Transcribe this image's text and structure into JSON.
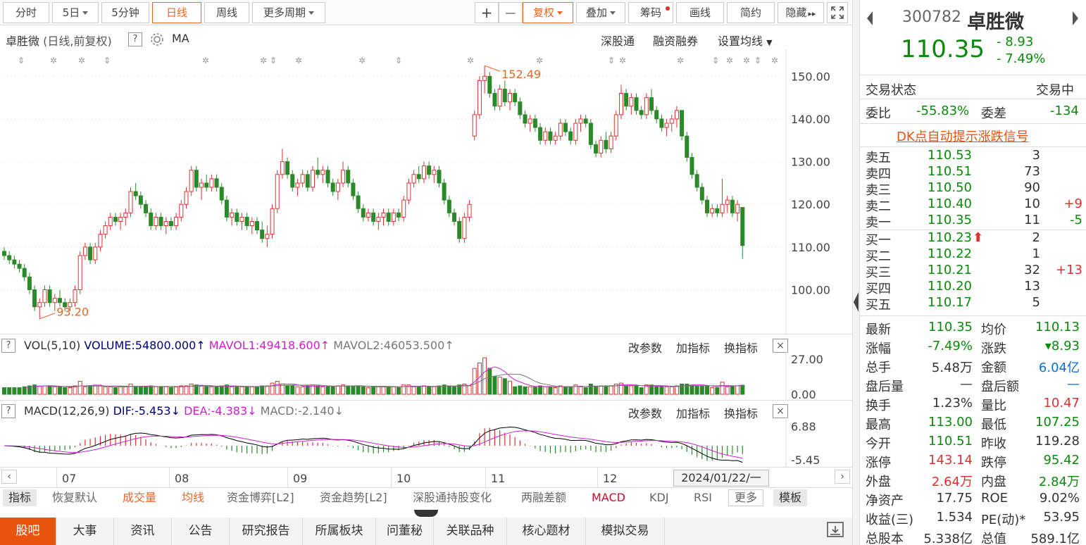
{
  "toolbar": {
    "tab_fenshi": "分时",
    "tab_5day": "5日",
    "tab_5min": "5分钟",
    "tab_daily": "日线",
    "tab_weekly": "周线",
    "tab_more": "更多周期",
    "plus": "+",
    "minus": "—",
    "fuquan": "复权",
    "diejia": "叠加",
    "chouma": "筹码",
    "huaxian": "画线",
    "jianyue": "简约",
    "yincang": "隐藏",
    "more_arrow": "▸▸"
  },
  "chart_header": {
    "title": "卓胜微",
    "subtitle": "(日线,前复权)",
    "help": "?",
    "ma": "MA",
    "link1": "深股通",
    "link2": "融资融券",
    "link3": "设置均线"
  },
  "price_annot": {
    "high": "152.49",
    "low": "93.20"
  },
  "chart_data": [
    {
      "type": "candlestick",
      "ylim": [
        92,
        155
      ],
      "y_ticks": [
        "150.00",
        "140.00",
        "130.00",
        "120.00",
        "110.00",
        "100.00"
      ],
      "y_tick_values": [
        150,
        140,
        130,
        120,
        110,
        100
      ],
      "x_ticks": [
        "07",
        "08",
        "09",
        "10",
        "11",
        "12"
      ],
      "last_date": "2024/01/22/一",
      "ohlc": [
        [
          109,
          110,
          107,
          108
        ],
        [
          108,
          109,
          106,
          107
        ],
        [
          107,
          108,
          105,
          106
        ],
        [
          106,
          107,
          104,
          105
        ],
        [
          105,
          106,
          102,
          103
        ],
        [
          103,
          104,
          99,
          100
        ],
        [
          100,
          101,
          95,
          96
        ],
        [
          96,
          98,
          93.2,
          97
        ],
        [
          97,
          101,
          96,
          100
        ],
        [
          100,
          101,
          96,
          97
        ],
        [
          97,
          99,
          95,
          98
        ],
        [
          98,
          100,
          96,
          97
        ],
        [
          97,
          98,
          95,
          96
        ],
        [
          96,
          98,
          95,
          97
        ],
        [
          97,
          101,
          96,
          100
        ],
        [
          100,
          109,
          99,
          108
        ],
        [
          108,
          111,
          107,
          110
        ],
        [
          110,
          111,
          106,
          107
        ],
        [
          107,
          111,
          106,
          110
        ],
        [
          110,
          114,
          109,
          113
        ],
        [
          113,
          116,
          112,
          115
        ],
        [
          115,
          118,
          114,
          117
        ],
        [
          117,
          118,
          115,
          116
        ],
        [
          116,
          118,
          114,
          117
        ],
        [
          117,
          119,
          115,
          118
        ],
        [
          118,
          124,
          117,
          123
        ],
        [
          123,
          125,
          121,
          122
        ],
        [
          122,
          123,
          119,
          120
        ],
        [
          120,
          121,
          117,
          118
        ],
        [
          118,
          119,
          114,
          115
        ],
        [
          115,
          118,
          114,
          117
        ],
        [
          117,
          118,
          114,
          115
        ],
        [
          115,
          117,
          113,
          116
        ],
        [
          116,
          117,
          114,
          115
        ],
        [
          115,
          118,
          114,
          117
        ],
        [
          117,
          121,
          116,
          120
        ],
        [
          120,
          124,
          119,
          123
        ],
        [
          123,
          129,
          122,
          128
        ],
        [
          128,
          129,
          123,
          124
        ],
        [
          124,
          126,
          121,
          125
        ],
        [
          125,
          127,
          123,
          124
        ],
        [
          124,
          127,
          123,
          126
        ],
        [
          126,
          127,
          123,
          124
        ],
        [
          124,
          125,
          120,
          121
        ],
        [
          121,
          122,
          116,
          117
        ],
        [
          117,
          119,
          115,
          118
        ],
        [
          118,
          119,
          115,
          116
        ],
        [
          116,
          118,
          114,
          117
        ],
        [
          117,
          118,
          114,
          115
        ],
        [
          115,
          117,
          113,
          116
        ],
        [
          116,
          117,
          113,
          114
        ],
        [
          114,
          116,
          111,
          112
        ],
        [
          112,
          115,
          110,
          113
        ],
        [
          113,
          120,
          112,
          119
        ],
        [
          119,
          128,
          118,
          127
        ],
        [
          127,
          133,
          126,
          130
        ],
        [
          130,
          131,
          126,
          127
        ],
        [
          127,
          128,
          123,
          124
        ],
        [
          124,
          126,
          122,
          125
        ],
        [
          125,
          128,
          124,
          127
        ],
        [
          127,
          128,
          123,
          124
        ],
        [
          124,
          129,
          123,
          128
        ],
        [
          128,
          131,
          126,
          127
        ],
        [
          127,
          129,
          125,
          128
        ],
        [
          128,
          129,
          124,
          125
        ],
        [
          125,
          126,
          122,
          123
        ],
        [
          123,
          126,
          121,
          125
        ],
        [
          125,
          130,
          124,
          128
        ],
        [
          128,
          129,
          124,
          125
        ],
        [
          125,
          126,
          121,
          122
        ],
        [
          122,
          123,
          118,
          119
        ],
        [
          119,
          120,
          116,
          117
        ],
        [
          117,
          119,
          116,
          118
        ],
        [
          118,
          119,
          115,
          116
        ],
        [
          116,
          118,
          114,
          117
        ],
        [
          117,
          119,
          115,
          118
        ],
        [
          118,
          119,
          115,
          116
        ],
        [
          116,
          119,
          115,
          118
        ],
        [
          118,
          119,
          116,
          117
        ],
        [
          117,
          122,
          116,
          121
        ],
        [
          121,
          126,
          120,
          125
        ],
        [
          125,
          128,
          124,
          127
        ],
        [
          127,
          129,
          125,
          126
        ],
        [
          126,
          130,
          125,
          129
        ],
        [
          129,
          130,
          126,
          127
        ],
        [
          127,
          129,
          125,
          128
        ],
        [
          128,
          129,
          124,
          125
        ],
        [
          125,
          126,
          120,
          121
        ],
        [
          121,
          122,
          117,
          118
        ],
        [
          118,
          119,
          115,
          116
        ],
        [
          116,
          117,
          111,
          112
        ],
        [
          112,
          118,
          111,
          117
        ],
        [
          117,
          121,
          116,
          120
        ],
        [
          136,
          142,
          135,
          141
        ],
        [
          141,
          150,
          140,
          149
        ],
        [
          149,
          152.49,
          146,
          150
        ],
        [
          150,
          151,
          145,
          146
        ],
        [
          146,
          147,
          142,
          143
        ],
        [
          143,
          148,
          142,
          147
        ],
        [
          147,
          149,
          143,
          144
        ],
        [
          144,
          147,
          142,
          146
        ],
        [
          146,
          147,
          143,
          144
        ],
        [
          144,
          145,
          140,
          141
        ],
        [
          141,
          142,
          138,
          139
        ],
        [
          139,
          141,
          137,
          140
        ],
        [
          140,
          141,
          137,
          138
        ],
        [
          138,
          139,
          134,
          135
        ],
        [
          135,
          138,
          134,
          137
        ],
        [
          137,
          138,
          134,
          135
        ],
        [
          135,
          137,
          134,
          136
        ],
        [
          136,
          140,
          135,
          139
        ],
        [
          139,
          140,
          136,
          137
        ],
        [
          137,
          138,
          134,
          135
        ],
        [
          135,
          140,
          134,
          139
        ],
        [
          139,
          141,
          137,
          140
        ],
        [
          140,
          141,
          138,
          139
        ],
        [
          139,
          140,
          133,
          134
        ],
        [
          134,
          135,
          131,
          132
        ],
        [
          132,
          136,
          131,
          135
        ],
        [
          135,
          137,
          132,
          133
        ],
        [
          133,
          137,
          132,
          136
        ],
        [
          136,
          142,
          135,
          141
        ],
        [
          141,
          148,
          140,
          146
        ],
        [
          146,
          147,
          142,
          143
        ],
        [
          143,
          146,
          141,
          145
        ],
        [
          145,
          146,
          141,
          142
        ],
        [
          142,
          143,
          140,
          141
        ],
        [
          141,
          146,
          140,
          145
        ],
        [
          145,
          147,
          141,
          142
        ],
        [
          142,
          143,
          139,
          140
        ],
        [
          140,
          141,
          137,
          138
        ],
        [
          138,
          140,
          136,
          139
        ],
        [
          139,
          141,
          137,
          140
        ],
        [
          140,
          143,
          138,
          142
        ],
        [
          142,
          142,
          135,
          136
        ],
        [
          136,
          137,
          130,
          131
        ],
        [
          131,
          132,
          126,
          127
        ],
        [
          127,
          128,
          123,
          124
        ],
        [
          124,
          125,
          120,
          121
        ],
        [
          121,
          122,
          117,
          118
        ],
        [
          118,
          120,
          117,
          119
        ],
        [
          119,
          120,
          117,
          118
        ],
        [
          118,
          126,
          117,
          120
        ],
        [
          120,
          122,
          118,
          121
        ],
        [
          121,
          122,
          117,
          118
        ],
        [
          118,
          121,
          116,
          120
        ],
        [
          119.28,
          113,
          107.25,
          110.35
        ]
      ]
    },
    {
      "type": "bar",
      "name": "VOL",
      "y_ticks": [
        "27.00",
        "0.00"
      ],
      "ylim": [
        0,
        30
      ]
    },
    {
      "type": "line",
      "name": "MACD",
      "y_ticks": [
        "6.88",
        "-5.45"
      ],
      "ylim": [
        -6,
        9
      ]
    }
  ],
  "vol_header": {
    "help": "?",
    "label": "VOL(5,10)",
    "volume": "VOLUME:54800.000",
    "mavol1": "MAVOL1:49418.600",
    "mavol2": "MAVOL2:46053.500",
    "gaicanshu": "改参数",
    "jiazhibiao": "加指标",
    "huanzhibiao": "换指标",
    "close": "×",
    "color_volume": "#000080",
    "color_mavol1": "#d020d0",
    "color_mavol2": "#777777"
  },
  "macd_header": {
    "help": "?",
    "label": "MACD(12,26,9)",
    "dif": "DIF:-5.453",
    "dea": "DEA:-4.383",
    "macd": "MACD:-2.140",
    "gaicanshu": "改参数",
    "jiazhibiao": "加指标",
    "huanzhibiao": "换指标",
    "close": "×"
  },
  "nav": {
    "left": "‹",
    "right": "›"
  },
  "indicator_tabs": [
    "指标",
    "恢复默认",
    "成交量",
    "均线",
    "资金博弈[L2]",
    "资金趋势[L2]",
    "深股通持股变化",
    "两融差额",
    "MACD",
    "KDJ",
    "RSI",
    "更多",
    "模板"
  ],
  "bottom_tabs": [
    "股吧",
    "大事",
    "资讯",
    "公告",
    "研究报告",
    "所属板块",
    "问董秘",
    "关联品种",
    "核心题材",
    "模拟交易"
  ],
  "quote": {
    "code": "300782",
    "name": "卓胜微",
    "price": "110.35",
    "change": "- 8.93",
    "change_pct": "- 7.49%",
    "status_label": "交易状态",
    "status_value": "交易中",
    "weibi_label": "委比",
    "weibi_value": "-55.83%",
    "weicha_label": "委差",
    "weicha_value": "-134",
    "dk_signal": "DK点自动提示涨跌信号",
    "asks": [
      {
        "label": "卖五",
        "price": "110.53",
        "vol": "3",
        "chg": ""
      },
      {
        "label": "卖四",
        "price": "110.51",
        "vol": "73",
        "chg": ""
      },
      {
        "label": "卖三",
        "price": "110.50",
        "vol": "90",
        "chg": ""
      },
      {
        "label": "卖二",
        "price": "110.40",
        "vol": "10",
        "chg": "+9"
      },
      {
        "label": "卖一",
        "price": "110.35",
        "vol": "11",
        "chg": "-5"
      }
    ],
    "bids": [
      {
        "label": "买一",
        "price": "110.23",
        "vol": "2",
        "chg": ""
      },
      {
        "label": "买二",
        "price": "110.22",
        "vol": "1",
        "chg": ""
      },
      {
        "label": "买三",
        "price": "110.21",
        "vol": "32",
        "chg": "+13"
      },
      {
        "label": "买四",
        "price": "110.20",
        "vol": "13",
        "chg": ""
      },
      {
        "label": "买五",
        "price": "110.17",
        "vol": "5",
        "chg": ""
      }
    ],
    "stats": [
      {
        "l1": "最新",
        "v1": "110.35",
        "c1": "dn",
        "l2": "均价",
        "v2": "110.13",
        "c2": "dn"
      },
      {
        "l1": "涨幅",
        "v1": "-7.49%",
        "c1": "dn",
        "l2": "涨跌",
        "v2": "▾8.93",
        "c2": "dn"
      },
      {
        "l1": "总手",
        "v1": "5.48万",
        "c1": "",
        "l2": "金额",
        "v2": "6.04亿",
        "c2": "bl"
      },
      {
        "l1": "盘后量",
        "v1": "—",
        "c1": "",
        "l2": "盘后额",
        "v2": "—",
        "c2": "bl"
      },
      {
        "l1": "换手",
        "v1": "1.23%",
        "c1": "",
        "l2": "量比",
        "v2": "10.47",
        "c2": "up"
      },
      {
        "l1": "最高",
        "v1": "113.00",
        "c1": "dn",
        "l2": "最低",
        "v2": "107.25",
        "c2": "dn"
      },
      {
        "l1": "今开",
        "v1": "110.51",
        "c1": "dn",
        "l2": "昨收",
        "v2": "119.28",
        "c2": ""
      },
      {
        "l1": "涨停",
        "v1": "143.14",
        "c1": "up",
        "l2": "跌停",
        "v2": "95.42",
        "c2": "dn"
      },
      {
        "l1": "外盘",
        "v1": "2.64万",
        "c1": "up",
        "l2": "内盘",
        "v2": "2.84万",
        "c2": "dn"
      },
      {
        "l1": "净资产",
        "v1": "17.75",
        "c1": "",
        "l2": "ROE",
        "v2": "9.02%",
        "c2": ""
      },
      {
        "l1": "收益(三)",
        "v1": "1.534",
        "c1": "",
        "l2": "PE(动)*",
        "v2": "53.95",
        "c2": ""
      },
      {
        "l1": "总股本",
        "v1": "5.338亿",
        "c1": "",
        "l2": "总值",
        "v2": "589.1亿",
        "c2": ""
      }
    ]
  },
  "colors": {
    "up": "#e03030",
    "down": "#1a9a1a",
    "accent": "#e8672a",
    "link": "#e8530e",
    "blue": "#0a6fd0"
  }
}
